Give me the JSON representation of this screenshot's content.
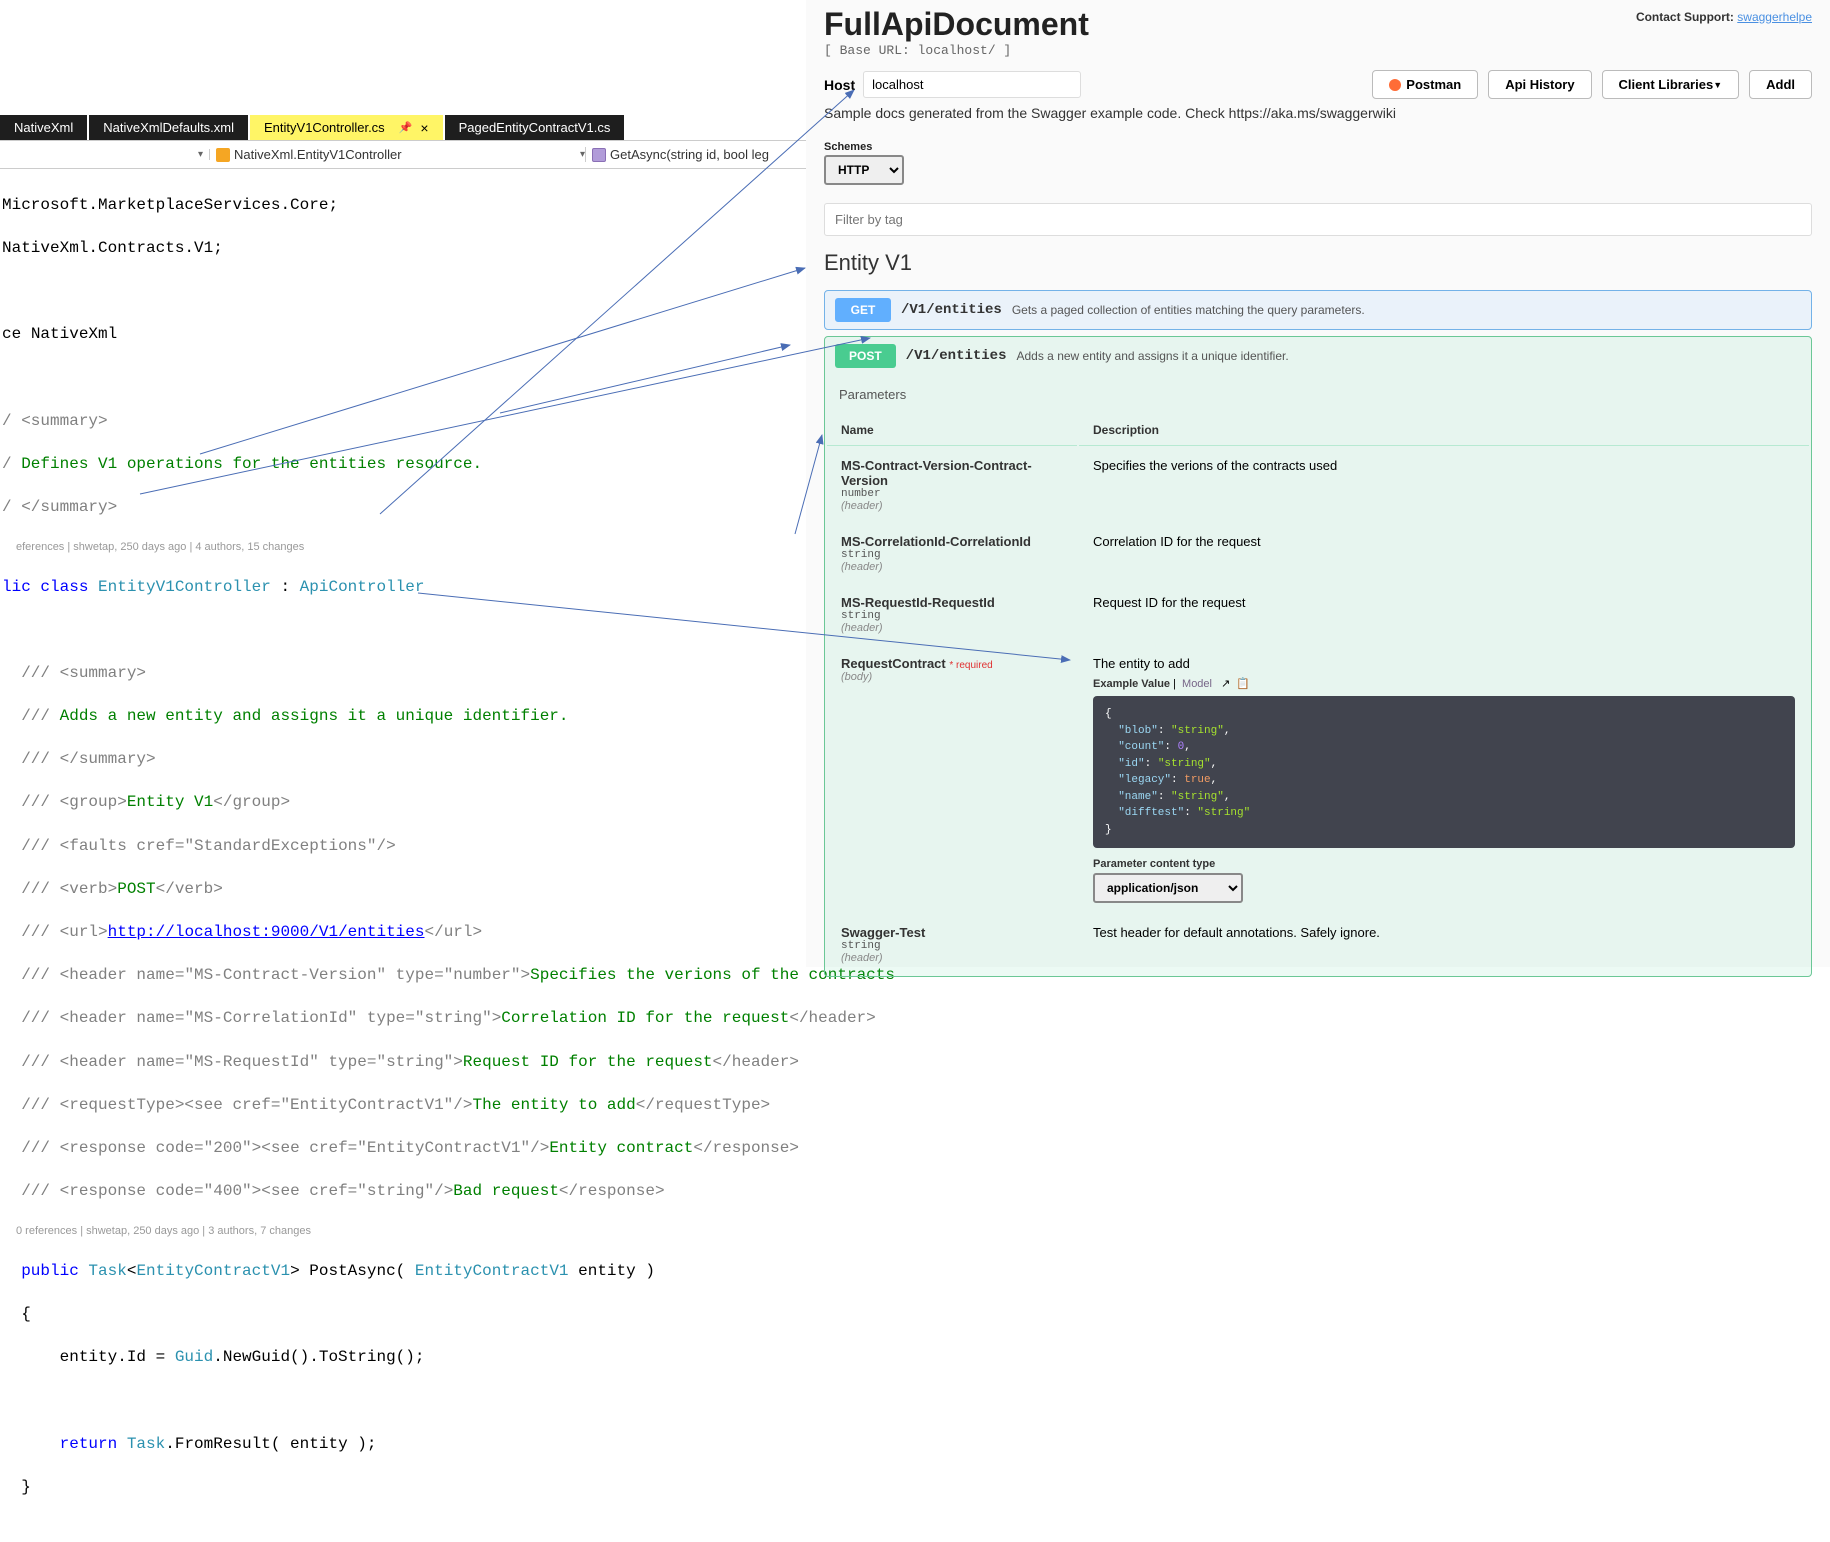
{
  "vs": {
    "tabs": [
      {
        "label": "NativeXml"
      },
      {
        "label": "NativeXmlDefaults.xml"
      },
      {
        "label": "EntityV1Controller.cs",
        "active": true
      },
      {
        "label": "PagedEntityContractV1.cs"
      }
    ],
    "nav_mid": "NativeXml.EntityV1Controller",
    "nav_right": "GetAsync(string id, bool leg",
    "code": {
      "using1": "Microsoft.MarketplaceServices.Core;",
      "using2": "NativeXml.Contracts.V1;",
      "ns_kw": "ce ",
      "ns_name": "NativeXml",
      "summary_open": "<summary>",
      "summary_text": "Defines V1 operations for the entities resource.",
      "summary_close": "</summary>",
      "codelens1": "eferences | shwetap, 250 days ago | 4 authors, 15 changes",
      "class_line_pre": "lic class ",
      "class_name": "EntityV1Controller",
      "class_sep": " : ",
      "base_class": "ApiController",
      "c_sum_open": "<summary>",
      "c_sum_text": "Adds a new entity and assigns it a unique identifier.",
      "c_sum_close": "</summary>",
      "group_open": "<group>",
      "group_val": "Entity V1",
      "group_close": "</group>",
      "faults_open": "<faults cref=",
      "faults_val": "\"StandardExceptions\"",
      "faults_close": "/>",
      "verb_open": "<verb>",
      "verb_val": "POST",
      "verb_close": "</verb>",
      "url_open": "<url>",
      "url_val": "http://localhost:9000/V1/entities",
      "url_close": "</url>",
      "h1_open": "<header name=",
      "h1_name": "\"MS-Contract-Version\"",
      "h1_type_kw": " type=",
      "h1_type": "\"number\"",
      "h1_close": ">",
      "h1_text": "Specifies the verions of the contracts",
      "h2_name": "\"MS-CorrelationId\"",
      "h2_type": "\"string\"",
      "h2_text": "Correlation ID for the request",
      "h2_end": "</header>",
      "h3_name": "\"MS-RequestId\"",
      "h3_type": "\"string\"",
      "h3_text": "Request ID for the request",
      "h3_end": "</header>",
      "req_open": "<requestType><see cref=",
      "req_val": "\"EntityContractV1\"",
      "req_close": "/>",
      "req_text": "The entity to add",
      "req_end": "</requestType>",
      "r200_open": "<response code=",
      "r200_code": "\"200\"",
      "r200_mid": "><see cref=",
      "r200_val": "\"EntityContractV1\"",
      "r200_close": "/>",
      "r200_text": "Entity contract",
      "r200_end": "</response>",
      "r400_open": "<response code=",
      "r400_code": "\"400\"",
      "r400_mid": "><see cref=",
      "r400_val": "\"string\"",
      "r400_close": "/>",
      "r400_text": "Bad request",
      "r400_end": "</response>",
      "codelens2": "0 references | shwetap, 250 days ago | 3 authors, 7 changes",
      "method_kw": "public ",
      "method_ret": "Task",
      "method_gen_open": "<",
      "method_gen": "EntityContractV1",
      "method_gen_close": "> ",
      "method_name": "PostAsync( ",
      "method_param_type": "EntityContractV1",
      "method_param": " entity )",
      "body_line": "    entity.Id = ",
      "guid_type": "Guid",
      "guid_call": ".NewGuid().ToString();",
      "ret_kw": "    return ",
      "task_type": "Task",
      "ret_call": ".FromResult( entity );"
    }
  },
  "swagger": {
    "title": "FullApiDocument",
    "base_url": "[ Base URL: localhost/ ]",
    "contact_label": "Contact Support:",
    "contact_link": "swaggerhelpe",
    "host_label": "Host",
    "host_value": "localhost",
    "buttons": {
      "postman": "Postman",
      "history": "Api History",
      "libs": "Client Libraries",
      "addl": "Addl"
    },
    "desc": "Sample docs generated from the Swagger example code. Check https://aka.ms/swaggerwiki",
    "schemes_label": "Schemes",
    "scheme": "HTTP",
    "filter_placeholder": "Filter by tag",
    "section": "Entity V1",
    "ops": {
      "get": {
        "method": "GET",
        "path": "/V1/entities",
        "desc": "Gets a paged collection of entities matching the query parameters."
      },
      "post": {
        "method": "POST",
        "path": "/V1/entities",
        "desc": "Adds a new entity and assigns it a unique identifier."
      }
    },
    "params_header": "Parameters",
    "th_name": "Name",
    "th_desc": "Description",
    "params": [
      {
        "name": "MS-Contract-Version-Contract-Version",
        "type": "number",
        "in": "(header)",
        "desc": "Specifies the verions of the contracts used"
      },
      {
        "name": "MS-CorrelationId-CorrelationId",
        "type": "string",
        "in": "(header)",
        "desc": "Correlation ID for the request"
      },
      {
        "name": "MS-RequestId-RequestId",
        "type": "string",
        "in": "(header)",
        "desc": "Request ID for the request"
      },
      {
        "name": "RequestContract",
        "type": "",
        "in": "(body)",
        "desc": "The entity to add",
        "required": true
      },
      {
        "name": "Swagger-Test",
        "type": "string",
        "in": "(header)",
        "desc": "Test header for default annotations. Safely ignore."
      }
    ],
    "example_label": "Example Value",
    "model_label": "Model",
    "json_example": "{\n  \"blob\": \"string\",\n  \"count\": 0,\n  \"id\": \"string\",\n  \"legacy\": true,\n  \"name\": \"string\",\n  \"difftest\": \"string\"\n}",
    "content_type_label": "Parameter content type",
    "content_type": "application/json",
    "required_label": "* required"
  }
}
